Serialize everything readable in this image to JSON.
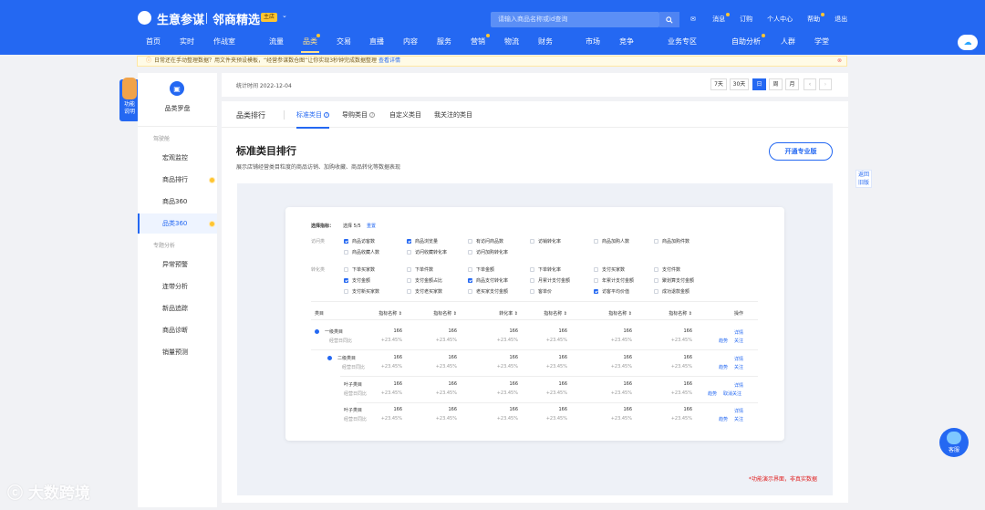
{
  "header": {
    "brand": "生意参谋",
    "shop_name": "邻商精选",
    "shop_badge": "主店",
    "search_placeholder": "请输入商品名称或id查询",
    "links": [
      "消息",
      "订购",
      "个人中心",
      "帮助",
      "退出"
    ],
    "nav": [
      "首页",
      "实时",
      "作战室",
      "流量",
      "品类",
      "交易",
      "直播",
      "内容",
      "服务",
      "营销",
      "物流",
      "财务",
      "市场",
      "竞争",
      "业务专区",
      "自助分析",
      "人群",
      "学堂"
    ],
    "active_nav": "品类"
  },
  "notice": {
    "text": "日常还在手动整理数据？用文件夹预设模板，“经营参谋数仓图”让你实现3秒钟完成数据整理",
    "link": "查看详情"
  },
  "float_tab": "功能说明",
  "sidebar": {
    "title": "品类罗盘",
    "group1": "驾驶舱",
    "items1": [
      "宏观监控",
      "商品排行",
      "商品360",
      "品类360"
    ],
    "group2": "专题分析",
    "items2": [
      "异常预警",
      "连带分析",
      "新品追踪",
      "商品诊断",
      "销量预测"
    ]
  },
  "statbar": {
    "stat_time": "统计时间 2022-12-04",
    "ranges": [
      "7天",
      "30天",
      "日",
      "周",
      "月"
    ],
    "active_range": "日"
  },
  "tabs": {
    "title": "品类排行",
    "items": [
      "标准类目",
      "导购类目",
      "自定义类目",
      "我关注的类目"
    ]
  },
  "main": {
    "heading": "标准类目排行",
    "description": "展示店铺经营类目粒度的商品访销、加购收藏、商品转化等数据表现",
    "pro_button": "开通专业版",
    "demo_note": "*功能演示界面，非真实数据"
  },
  "selector": {
    "label": "选择指标：",
    "count": "选择 5/5",
    "reset": "重置",
    "group1": "访问类",
    "group2": "转化类",
    "row1": [
      "商品访客数",
      "商品浏览量",
      "有访问商品数",
      "访销转化率",
      "商品加购人数",
      "商品加购件数"
    ],
    "row1_checked": [
      true,
      true,
      false,
      false,
      false,
      false
    ],
    "row2": [
      "商品收藏人数",
      "访问收藏转化率",
      "访问加购转化率"
    ],
    "row2_checked": [
      false,
      false,
      false
    ],
    "row3": [
      "下单买家数",
      "下单件数",
      "下单金额",
      "下单转化率",
      "支付买家数",
      "支付件数"
    ],
    "row3_checked": [
      false,
      false,
      false,
      false,
      false,
      false
    ],
    "row4": [
      "支付金额",
      "支付金额占比",
      "商品支付转化率",
      "月累计支付金额",
      "年累计支付金额",
      "聚划算支付金额"
    ],
    "row4_checked": [
      true,
      false,
      true,
      false,
      false,
      false
    ],
    "row5": [
      "支付新买家数",
      "支付老买家数",
      "老买家支付金额",
      "客单价",
      "访客平均价值",
      "成功退款金额"
    ],
    "row5_checked": [
      false,
      false,
      false,
      false,
      true,
      false
    ]
  },
  "table": {
    "headers": [
      "类目",
      "指标名称",
      "指标名称",
      "转化率",
      "指标名称",
      "指标名称",
      "指标名称",
      "操作"
    ],
    "rows": [
      {
        "name": "一级类目",
        "sub": "经营日同比",
        "value": "166",
        "delta": "+23.45%",
        "actions": [
          "详情",
          "趋势",
          "关注"
        ]
      },
      {
        "name": "二级类目",
        "sub": "经营日同比",
        "value": "166",
        "delta": "+23.45%",
        "actions": [
          "详情",
          "趋势",
          "关注"
        ]
      },
      {
        "name": "叶子类目",
        "sub": "经营日同比",
        "value": "166",
        "delta": "+23.45%",
        "actions": [
          "详情",
          "趋势",
          "取消关注"
        ]
      },
      {
        "name": "叶子类目",
        "sub": "经营日同比",
        "value": "166",
        "delta": "+23.45%",
        "actions": [
          "详情",
          "趋势",
          "关注"
        ]
      }
    ]
  },
  "right_note": "返回旧版",
  "help_button": "客服",
  "watermark": "大数跨境",
  "colors": {
    "primary": "#2468f2",
    "accent": "#ffc531",
    "warning": "#e02020"
  }
}
